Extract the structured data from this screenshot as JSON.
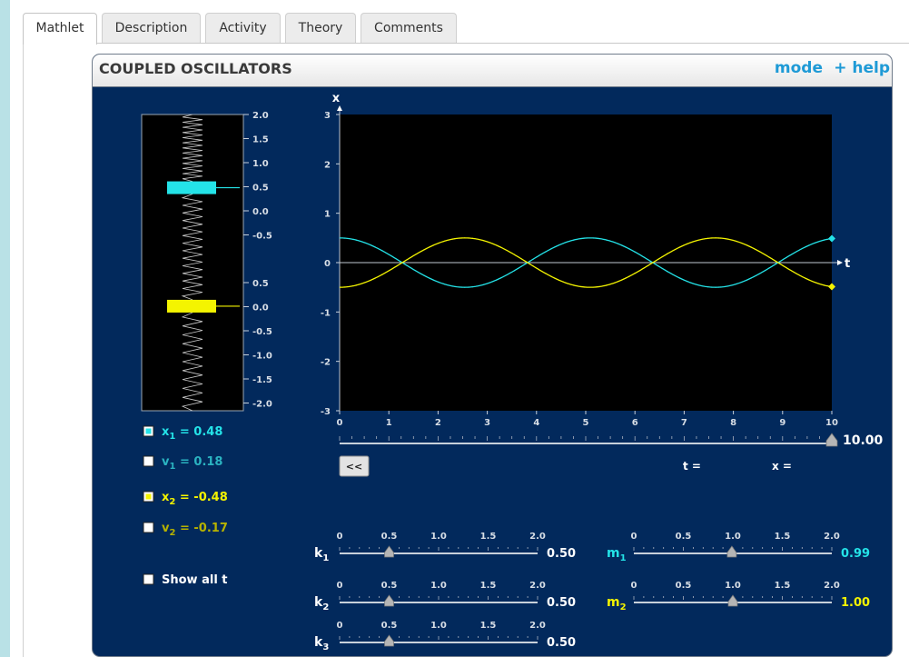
{
  "tabs": [
    {
      "label": "Mathlet",
      "active": true
    },
    {
      "label": "Description",
      "active": false
    },
    {
      "label": "Activity",
      "active": false
    },
    {
      "label": "Theory",
      "active": false
    },
    {
      "label": "Comments",
      "active": false
    }
  ],
  "header": {
    "title": "COUPLED OSCILLATORS",
    "mode_label": "mode",
    "help_label": "+ help"
  },
  "colors": {
    "mass1": "#24e3e8",
    "mass2": "#f4f400",
    "panel": "#02295c",
    "link": "#1e9ad6"
  },
  "spring_view": {
    "upper_ticks": [
      "2.0",
      "1.5",
      "1.0",
      "0.5",
      "0.0",
      "-0.5"
    ],
    "lower_ticks": [
      "0.5",
      "0.0",
      "-0.5",
      "-1.0",
      "-1.5",
      "-2.0"
    ],
    "mass1_displacement": 0.48,
    "mass2_displacement": -0.48
  },
  "graph": {
    "x_axis_label": "t",
    "y_axis_label": "x",
    "x_range": [
      0,
      10
    ],
    "y_range": [
      -3,
      3
    ],
    "x_ticks": [
      "0",
      "1",
      "2",
      "3",
      "4",
      "5",
      "6",
      "7",
      "8",
      "9",
      "10"
    ],
    "y_ticks": [
      "3",
      "2",
      "1",
      "0",
      "-1",
      "-2",
      "-3"
    ],
    "amplitude": 0.5,
    "period": 5.09
  },
  "time_slider": {
    "value_label": "10.00",
    "value": 10,
    "max": 10
  },
  "rewind_label": "<<",
  "readouts": {
    "t_label": "t =",
    "x_label": "x ="
  },
  "checkboxes": [
    {
      "label_main": "x",
      "sub": "1",
      "value": " = 0.48",
      "checked": true,
      "color": "#24e3e8"
    },
    {
      "label_main": "v",
      "sub": "1",
      "value": " = 0.18",
      "checked": false,
      "color": "#2bb3c1"
    },
    {
      "label_main": "x",
      "sub": "2",
      "value": " = -0.48",
      "checked": true,
      "color": "#f4f400"
    },
    {
      "label_main": "v",
      "sub": "2",
      "value": " = -0.17",
      "checked": false,
      "color": "#b6b200"
    }
  ],
  "show_all_t": {
    "label": "Show all t",
    "checked": false
  },
  "slider_ticks": [
    "0",
    "0.5",
    "1.0",
    "1.5",
    "2.0"
  ],
  "sliders": [
    {
      "name": "k",
      "sub": "1",
      "value": 0.5,
      "value_label": "0.50",
      "color": "#ffffff"
    },
    {
      "name": "k",
      "sub": "2",
      "value": 0.5,
      "value_label": "0.50",
      "color": "#ffffff"
    },
    {
      "name": "k",
      "sub": "3",
      "value": 0.5,
      "value_label": "0.50",
      "color": "#ffffff"
    },
    {
      "name": "m",
      "sub": "1",
      "value": 0.99,
      "value_label": "0.99",
      "color": "#24e3e8"
    },
    {
      "name": "m",
      "sub": "2",
      "value": 1.0,
      "value_label": "1.00",
      "color": "#f4f400"
    }
  ]
}
